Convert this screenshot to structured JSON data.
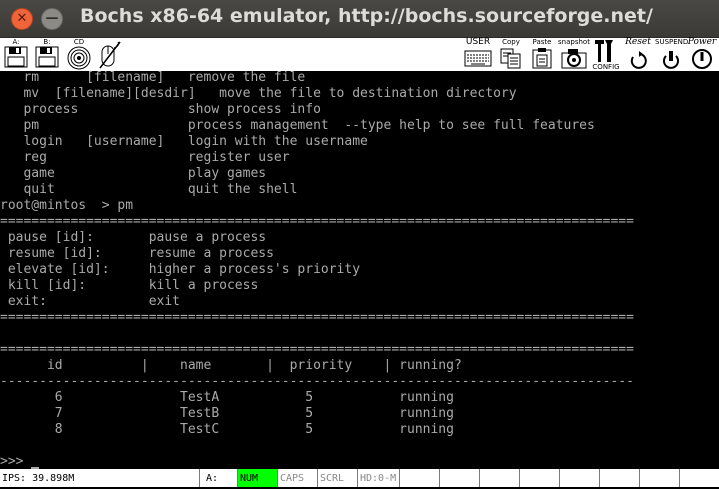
{
  "window": {
    "title": "Bochs x86-64 emulator, http://bochs.sourceforge.net/",
    "close_glyph": "✕",
    "min_glyph": "—"
  },
  "toolbar": {
    "floppy_a_label": "A:",
    "floppy_b_label": "B:",
    "cdrom_label": "CD",
    "user_label": "USER",
    "copy_label": "Copy",
    "paste_label": "Paste",
    "snapshot_label": "snapshot",
    "config_label": "CONFIG",
    "reset_label": "Reset",
    "suspend_label": "SUSPEND",
    "power_label": "Power"
  },
  "console": {
    "lines": [
      "   rm      [filename]   remove the file",
      "   mv  [filename][desdir]   move the file to destination directory",
      "   process              show process info",
      "   pm                   process management  --type help to see full features",
      "   login   [username]   login with the username",
      "   reg                  register user",
      "   game                 play games",
      "   quit                 quit the shell",
      "root@mintos  > pm",
      "=================================================================================",
      " pause [id]:       pause a process",
      " resume [id]:      resume a process",
      " elevate [id]:     higher a process's priority",
      " kill [id]:        kill a process",
      " exit:             exit",
      "=================================================================================",
      "",
      "=================================================================================",
      "      id          |    name       |  priority    | running?",
      "---------------------------------------------------------------------------------",
      "",
      "       6               TestA           5           running",
      "       7               TestB           5           running",
      "       8               TestC           5           running",
      "",
      ">>> "
    ]
  },
  "statusbar": {
    "ips": "IPS: 39.898M",
    "drive": "A:",
    "num": "NUM",
    "caps": "CAPS",
    "scrl": "SCRL",
    "hd": "HD:0-M"
  },
  "colors": {
    "console_text": "#aaaaaa",
    "console_bg": "#000000",
    "num_lock_on": "#00ff00"
  }
}
